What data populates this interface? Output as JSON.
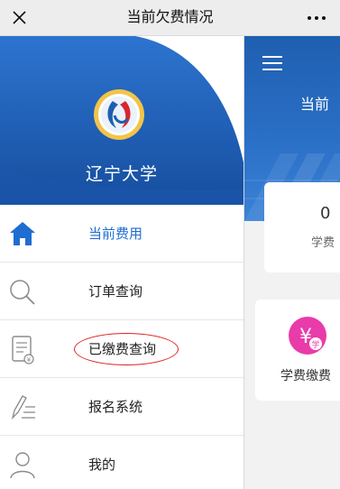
{
  "navbar": {
    "title": "当前欠费情况",
    "close_icon": "close-icon",
    "more_icon": "more-icon",
    "more_glyph": "···"
  },
  "drawer": {
    "school_name": "辽宁大学",
    "logo_icon": "university-logo",
    "header_color": "#1c5bb5",
    "menu": [
      {
        "label": "当前费用",
        "icon": "home-icon",
        "active": true
      },
      {
        "label": "订单查询",
        "icon": "search-icon",
        "active": false
      },
      {
        "label": "已缴费查询",
        "icon": "receipt-icon",
        "active": false,
        "circled": true
      },
      {
        "label": "报名系统",
        "icon": "edit-list-icon",
        "active": false
      },
      {
        "label": "我的",
        "icon": "user-icon",
        "active": false
      }
    ]
  },
  "main": {
    "hero_title": "当前",
    "menu_icon": "hamburger-menu-icon",
    "card_value": "0",
    "card_label": "学费",
    "tile_label": "学费缴费",
    "tile_icon": "yuan-coin-icon",
    "accent": "#2a6fc6",
    "tile_color": "#e93ba9"
  }
}
